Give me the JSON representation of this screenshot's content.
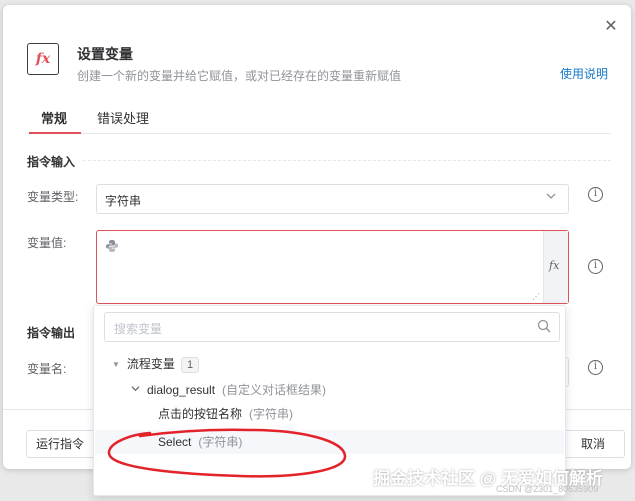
{
  "dialog": {
    "close_symbol": "✕",
    "icon_text": "fx",
    "title": "设置变量",
    "subtitle": "创建一个新的变量并给它赋值，或对已经存在的变量重新赋值",
    "help_link": "使用说明"
  },
  "tabs": [
    {
      "label": "常规",
      "active": true
    },
    {
      "label": "错误处理",
      "active": false
    }
  ],
  "sections": {
    "input": "指令输入",
    "output": "指令输出"
  },
  "fields": {
    "var_type_label": "变量类型:",
    "var_type_value": "字符串",
    "var_value_label": "变量值:",
    "var_name_label": "变量名:"
  },
  "value_box": {
    "python_icon": "python-icon",
    "fx_label": "fx",
    "value": ""
  },
  "dropdown": {
    "search_placeholder": "搜索变量",
    "group": {
      "label": "流程变量",
      "count": "1"
    },
    "node": {
      "label": "dialog_result",
      "type": "(自定义对话框结果)"
    },
    "items": [
      {
        "label": "点击的按钮名称",
        "type": "(字符串)"
      },
      {
        "label": "Select",
        "type": "(字符串)"
      }
    ]
  },
  "footer": {
    "run_button": "运行指令",
    "cancel_button": "取消"
  },
  "watermark": {
    "main": "掘金技术社区 @ 无爱如何解析",
    "sub": "CSDN @2301_80635909"
  },
  "colors": {
    "accent": "#e0525a",
    "link": "#1677c9",
    "annotation": "#e3232a"
  }
}
